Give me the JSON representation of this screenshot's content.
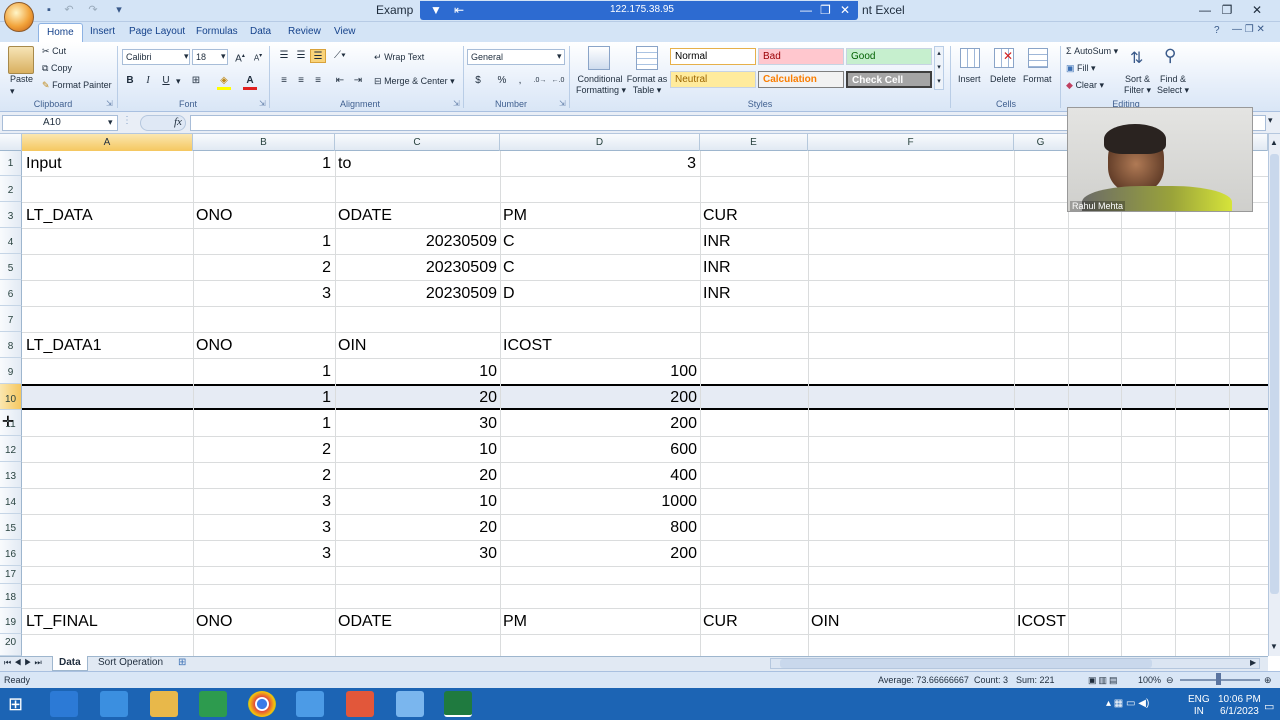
{
  "window": {
    "title": "Example of ... and the Loop: Nested ... Sorting - Microsoft Excel",
    "title_visible": "Examp",
    "title_tail": "nt Excel",
    "remote_ip": "122.175.38.95",
    "controls": {
      "minimize": "—",
      "restore": "❐",
      "close": "✕"
    }
  },
  "ribbon_tabs": [
    "Home",
    "Insert",
    "Page Layout",
    "Formulas",
    "Data",
    "Review",
    "View"
  ],
  "clipboard": {
    "paste": "Paste",
    "cut": "Cut",
    "copy": "Copy",
    "format_painter": "Format Painter",
    "label": "Clipboard"
  },
  "font": {
    "name": "Calibri",
    "size": "18",
    "bold": "B",
    "italic": "I",
    "underline": "U",
    "label": "Font"
  },
  "alignment": {
    "wrap_text": "Wrap Text",
    "merge_center": "Merge & Center",
    "label": "Alignment"
  },
  "number": {
    "format": "General",
    "currency": "$",
    "percent": "%",
    "comma": ",",
    "label": "Number"
  },
  "styles": {
    "conditional": "Conditional",
    "conditional2": "Formatting",
    "format_table": "Format as",
    "format_table2": "Table",
    "cells": [
      {
        "label": "Normal",
        "bg": "#ffffff",
        "fg": "#000000"
      },
      {
        "label": "Bad",
        "bg": "#ffc7ce",
        "fg": "#9c0006"
      },
      {
        "label": "Good",
        "bg": "#c6efce",
        "fg": "#006100"
      },
      {
        "label": "Neutral",
        "bg": "#ffeb9c",
        "fg": "#9c6500"
      },
      {
        "label": "Calculation",
        "bg": "#f2f2f2",
        "fg": "#fa7d00"
      },
      {
        "label": "Check Cell",
        "bg": "#a5a5a5",
        "fg": "#ffffff"
      }
    ],
    "label": "Styles"
  },
  "cells_group": {
    "insert": "Insert",
    "delete": "Delete",
    "format": "Format",
    "label": "Cells"
  },
  "editing": {
    "autosum": "AutoSum",
    "fill": "Fill",
    "clear": "Clear",
    "sort": "Sort &",
    "sort2": "Filter",
    "find": "Find &",
    "find2": "Select",
    "label": "Editing"
  },
  "formula_bar": {
    "name_box": "A10",
    "fx": "fx",
    "value": ""
  },
  "columns": [
    "A",
    "B",
    "C",
    "D",
    "E",
    "F",
    "G"
  ],
  "rows": [
    "1",
    "2",
    "3",
    "4",
    "5",
    "6",
    "7",
    "8",
    "9",
    "10",
    "11",
    "12",
    "13",
    "14",
    "15",
    "16",
    "17",
    "18",
    "19",
    "20"
  ],
  "sheet": {
    "r1": {
      "A": "Input",
      "B": "1",
      "C": "to",
      "D": "3"
    },
    "r3": {
      "A": "LT_DATA",
      "B": "ONO",
      "C": "ODATE",
      "D": "PM",
      "E": "CUR"
    },
    "r4": {
      "B": "1",
      "C": "20230509",
      "D": "C",
      "E": "INR"
    },
    "r5": {
      "B": "2",
      "C": "20230509",
      "D": "C",
      "E": "INR"
    },
    "r6": {
      "B": "3",
      "C": "20230509",
      "D": "D",
      "E": "INR"
    },
    "r8": {
      "A": "LT_DATA1",
      "B": "ONO",
      "C": "OIN",
      "D": "ICOST"
    },
    "r9": {
      "B": "1",
      "C": "10",
      "D": "100"
    },
    "r10": {
      "B": "1",
      "C": "20",
      "D": "200"
    },
    "r11": {
      "B": "1",
      "C": "30",
      "D": "200"
    },
    "r12": {
      "B": "2",
      "C": "10",
      "D": "600"
    },
    "r13": {
      "B": "2",
      "C": "20",
      "D": "400"
    },
    "r14": {
      "B": "3",
      "C": "10",
      "D": "1000"
    },
    "r15": {
      "B": "3",
      "C": "20",
      "D": "800"
    },
    "r16": {
      "B": "3",
      "C": "30",
      "D": "200"
    },
    "r19": {
      "A": "LT_FINAL",
      "B": "ONO",
      "C": "ODATE",
      "D": "PM",
      "E": "CUR",
      "F": "OIN",
      "G": "ICOST"
    }
  },
  "webcam": {
    "name": "Rahul Mehta"
  },
  "sheet_tabs": [
    "Data",
    "Sort Operation"
  ],
  "status": {
    "ready": "Ready",
    "average": "Average: 73.66666667",
    "count": "Count: 3",
    "sum": "Sum: 221",
    "zoom": "100%"
  },
  "taskbar": {
    "lang": "ENG",
    "region": "IN",
    "time": "10:06 PM",
    "date": "6/1/2023"
  }
}
